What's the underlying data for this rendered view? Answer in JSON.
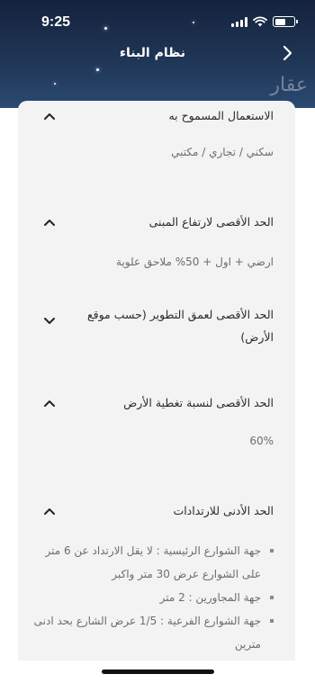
{
  "status_bar": {
    "time": "9:25"
  },
  "header": {
    "title": "نظام البناء",
    "watermark": "عقار"
  },
  "sections": [
    {
      "title": "الاستعمال المسموح به",
      "state": "expanded",
      "body": "سكني / تجاري / مكتبي"
    },
    {
      "title": "الحد الأقصى لارتفاع المبنى",
      "state": "expanded",
      "body": "ارضي + اول + 50% ملاحق علوية"
    },
    {
      "title": "الحد الأقصى لعمق التطوير (حسب موقع الأرض)",
      "state": "collapsed"
    },
    {
      "title": "الحد الأقصى لنسبة تغطية الأرض",
      "state": "expanded",
      "body": "60%"
    },
    {
      "title": "الحد الأدنى للارتدادات",
      "state": "expanded",
      "items": [
        "جهة الشوارع الرئيسية : لا يقل الارتداد عن 6 متر على الشوارع عرض 30 متر واكبر",
        "جهة المجاورين : 2 متر",
        "جهة الشوارع الفرعية : 1/5 عرض الشارع بحد ادنى مترين"
      ]
    }
  ],
  "icons": {
    "back": "chevron-right-icon",
    "expanded": "chevron-up-icon",
    "collapsed": "chevron-down-icon"
  },
  "colors": {
    "header": "#1f3556",
    "sheet": "#f3f3f4",
    "text": "#2b2b2b",
    "muted": "#6d6d6d"
  }
}
